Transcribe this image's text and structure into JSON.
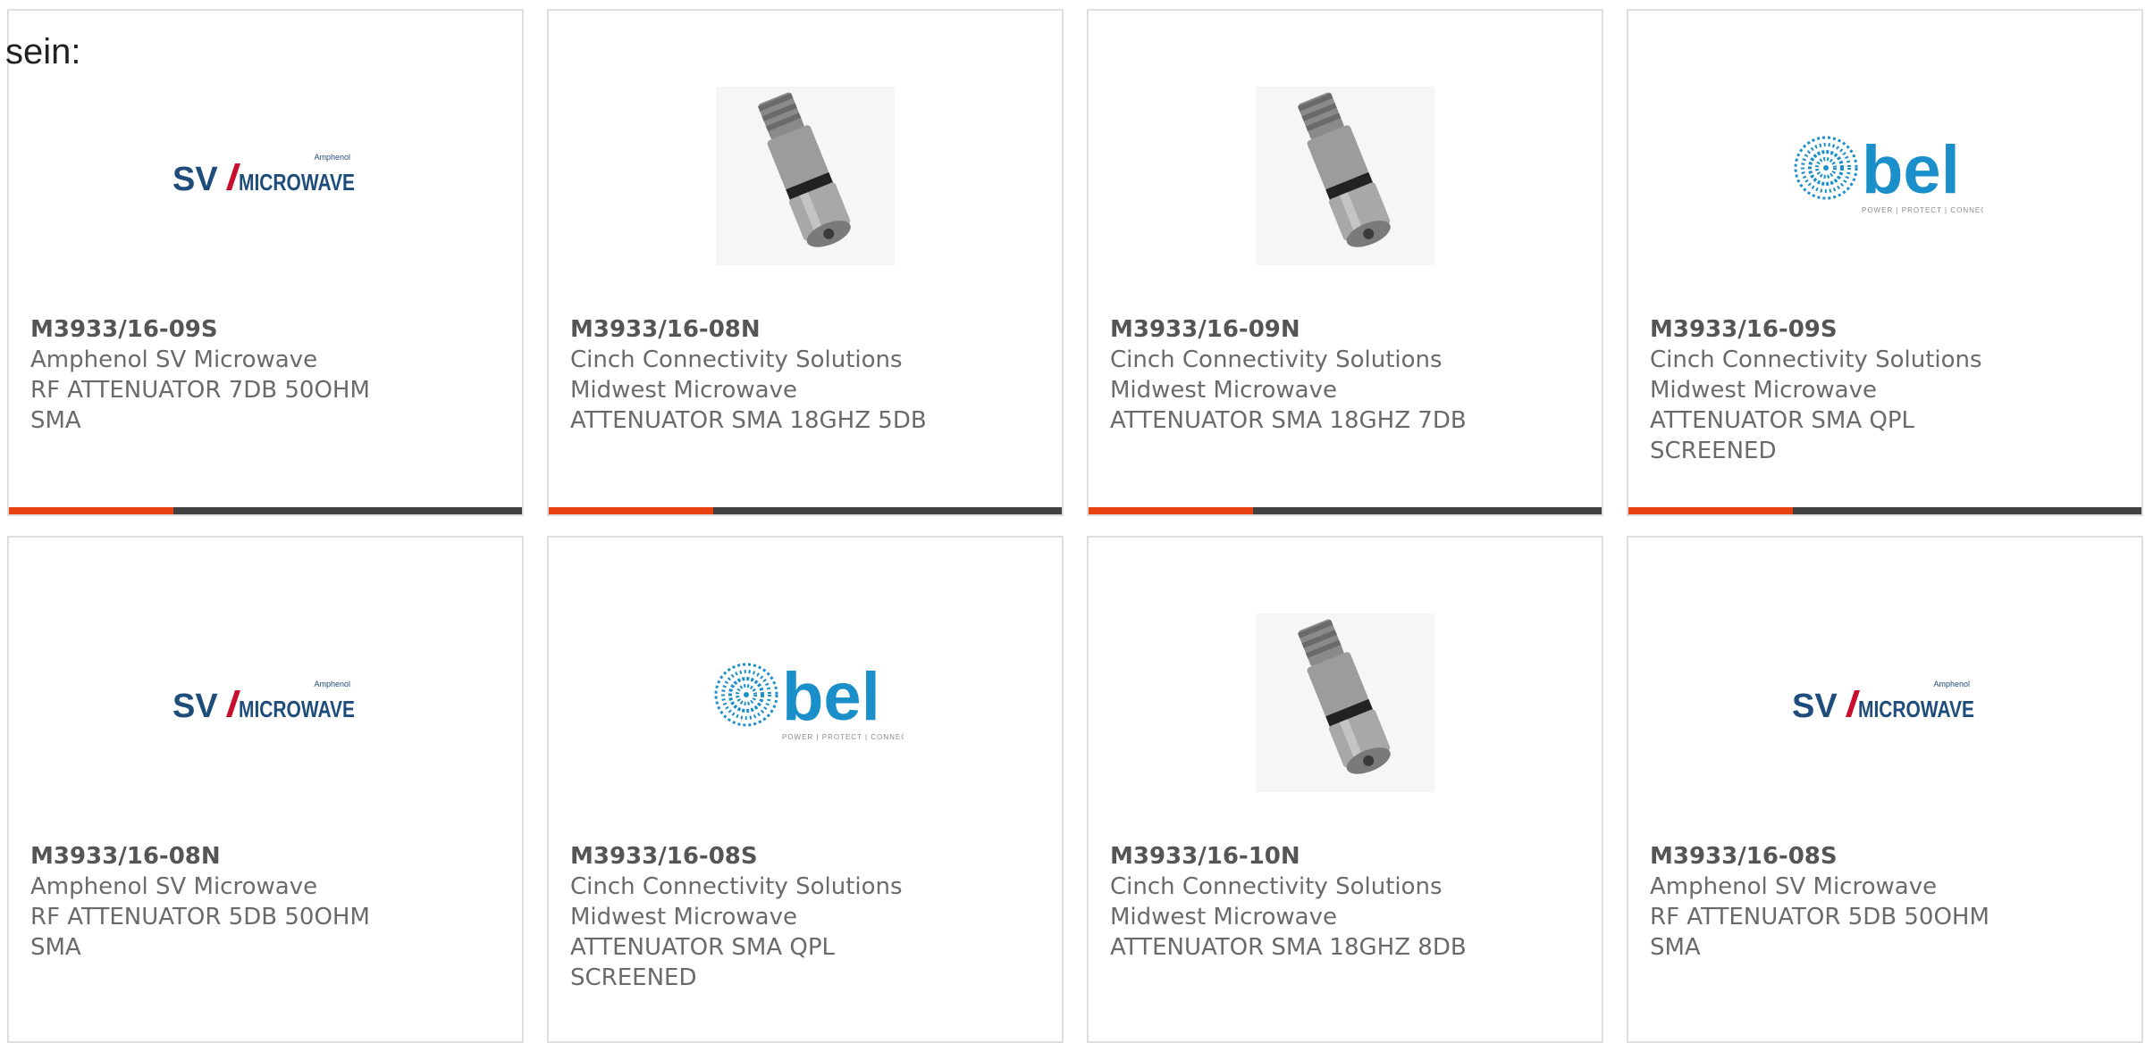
{
  "intro_text": "sein:",
  "logos": {
    "sv_small": "Amphenol",
    "sv_main": "MICROWAVE",
    "bel_main": "bel",
    "bel_tagline": "POWER | PROTECT | CONNECT"
  },
  "colors": {
    "accent": "#e8410f",
    "bar": "#404040",
    "border": "#dedede",
    "sv_blue": "#1e4d7b",
    "sv_red": "#c8102e",
    "bel_blue": "#1a8fc9"
  },
  "products": [
    {
      "part": "M3933/16-09S",
      "manufacturer": "Amphenol SV Microwave",
      "desc1": "RF ATTENUATOR 7DB 50OHM",
      "desc2": "SMA",
      "image": "sv-logo"
    },
    {
      "part": "M3933/16-08N",
      "manufacturer": "Cinch Connectivity Solutions",
      "desc1": "Midwest Microwave",
      "desc2": "ATTENUATOR SMA 18GHZ 5DB",
      "image": "attenuator-photo"
    },
    {
      "part": "M3933/16-09N",
      "manufacturer": "Cinch Connectivity Solutions",
      "desc1": "Midwest Microwave",
      "desc2": "ATTENUATOR SMA 18GHZ 7DB",
      "image": "attenuator-photo"
    },
    {
      "part": "M3933/16-09S",
      "manufacturer": "Cinch Connectivity Solutions",
      "desc1": "Midwest Microwave",
      "desc2": "ATTENUATOR SMA QPL",
      "desc3": "SCREENED",
      "image": "bel-logo"
    },
    {
      "part": "M3933/16-08N",
      "manufacturer": "Amphenol SV Microwave",
      "desc1": "RF ATTENUATOR 5DB 50OHM",
      "desc2": "SMA",
      "image": "sv-logo"
    },
    {
      "part": "M3933/16-08S",
      "manufacturer": "Cinch Connectivity Solutions",
      "desc1": "Midwest Microwave",
      "desc2": "ATTENUATOR SMA QPL",
      "desc3": "SCREENED",
      "image": "bel-logo"
    },
    {
      "part": "M3933/16-10N",
      "manufacturer": "Cinch Connectivity Solutions",
      "desc1": "Midwest Microwave",
      "desc2": "ATTENUATOR SMA 18GHZ 8DB",
      "image": "attenuator-photo"
    },
    {
      "part": "M3933/16-08S",
      "manufacturer": "Amphenol SV Microwave",
      "desc1": "RF ATTENUATOR 5DB 50OHM",
      "desc2": "SMA",
      "image": "sv-logo"
    }
  ]
}
